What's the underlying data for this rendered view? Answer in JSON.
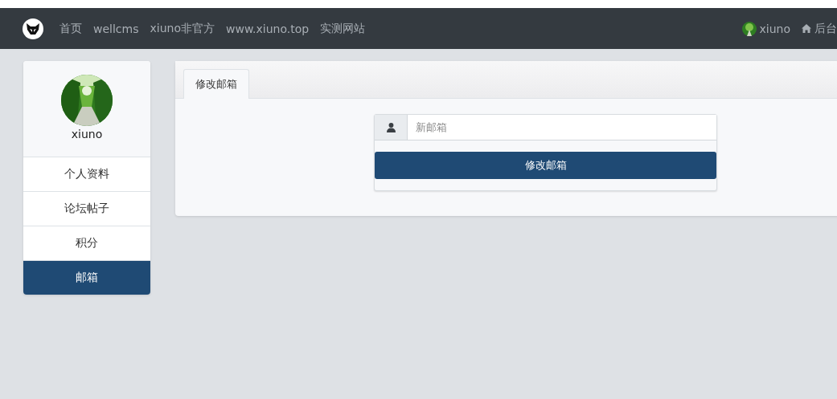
{
  "navbar": {
    "links": [
      {
        "label": "首页"
      },
      {
        "label": "wellcms"
      },
      {
        "label": "xiuno非官方"
      },
      {
        "label": "www.xiuno.top"
      },
      {
        "label": "实测网站"
      }
    ],
    "user": {
      "name": "xiuno"
    },
    "admin": {
      "label": "后台"
    }
  },
  "sidebar": {
    "username": "xiuno",
    "items": [
      {
        "label": "个人资料",
        "selected": false
      },
      {
        "label": "论坛帖子",
        "selected": false
      },
      {
        "label": "积分",
        "selected": false
      },
      {
        "label": "邮箱",
        "selected": true
      }
    ]
  },
  "main": {
    "tabs": [
      {
        "label": "修改邮箱",
        "selected": true
      }
    ],
    "email_field": {
      "placeholder": "新邮箱"
    },
    "submit_button": {
      "label": "修改邮箱"
    }
  }
}
